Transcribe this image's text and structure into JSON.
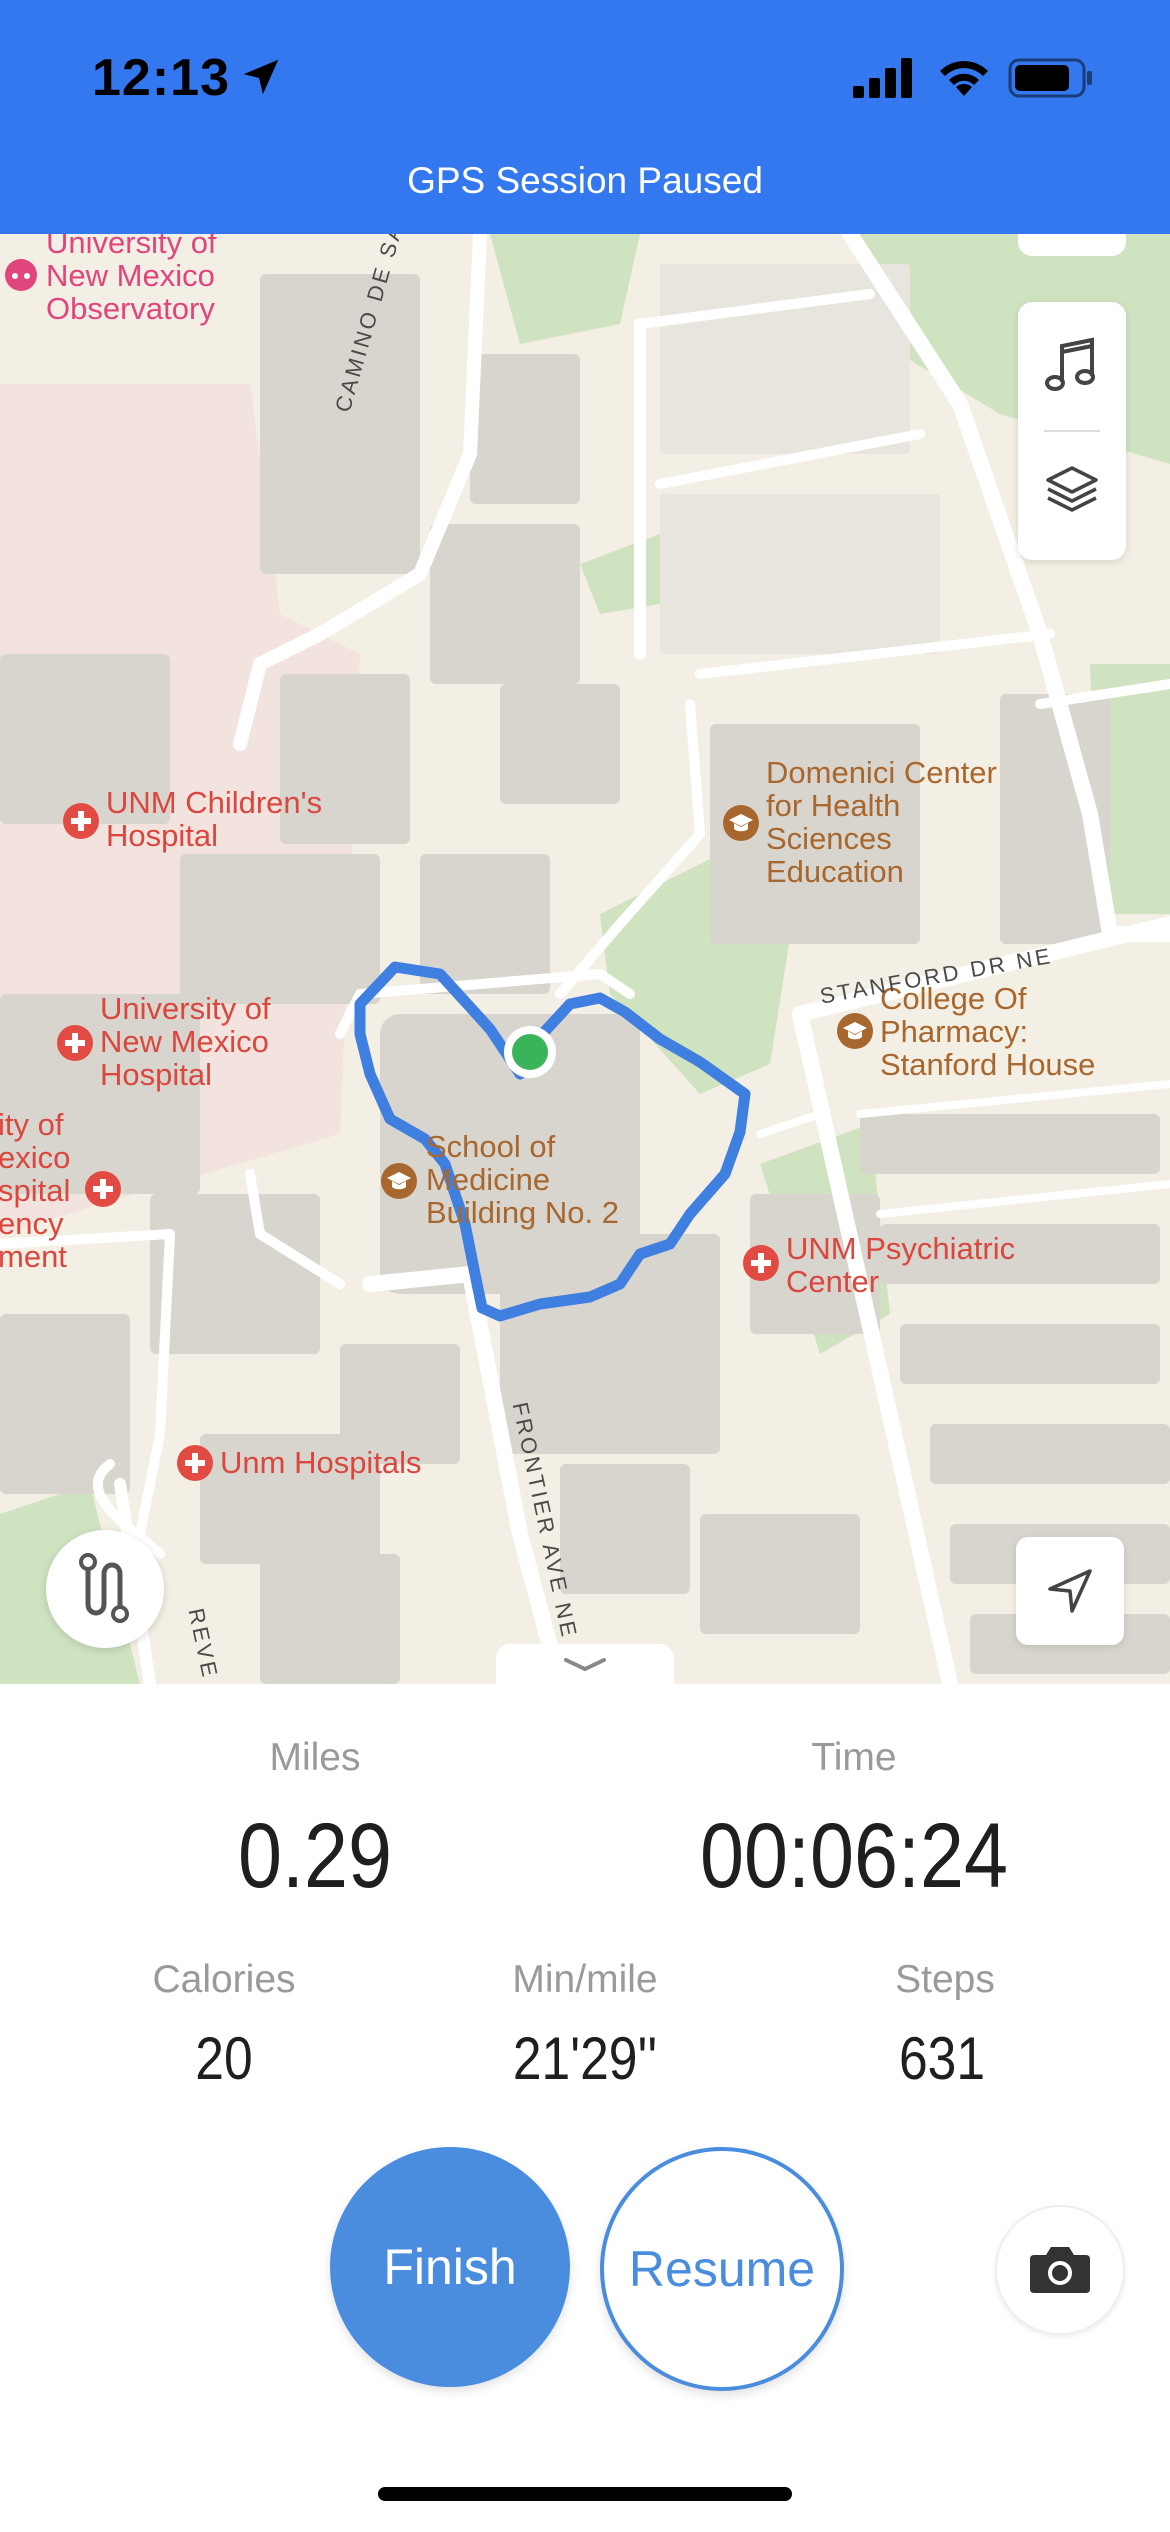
{
  "status_bar": {
    "time": "12:13"
  },
  "header": {
    "title": "GPS Session Paused"
  },
  "map": {
    "pois": [
      {
        "label": "University of New Mexico Observatory",
        "line1": "University of",
        "line2": "New Mexico",
        "line3": "Observatory"
      },
      {
        "label": "UNM Children's Hospital",
        "line1": "UNM Children's",
        "line2": "Hospital"
      },
      {
        "label": "University of New Mexico Hospital",
        "line1": "University of",
        "line2": "New Mexico",
        "line3": "Hospital"
      },
      {
        "line1": "ity of",
        "line2": "exico",
        "line3": "spital",
        "line4": "ency",
        "line5": "ment"
      },
      {
        "label": "Domenici Center for Health Sciences Education",
        "line1": "Domenici Center",
        "line2": "for Health",
        "line3": "Sciences",
        "line4": "Education"
      },
      {
        "label": "College Of Pharmacy: Stanford House",
        "line1": "College Of",
        "line2": "Pharmacy:",
        "line3": "Stanford House"
      },
      {
        "label": "School of Medicine Building No. 2",
        "line1": "School of",
        "line2": "Medicine",
        "line3": "Building No. 2"
      },
      {
        "label": "UNM Psychiatric Center",
        "line1": "UNM Psychiatric",
        "line2": "Center"
      },
      {
        "label": "Unm Hospitals",
        "line1": "Unm Hospitals"
      }
    ],
    "streets": {
      "camino": "CAMINO DE SALUD",
      "stanford": "STANFORD DR NE",
      "frontier": "FRONTIER AVE NE",
      "revere": "REVE"
    },
    "controls": [
      "music-icon",
      "layers-icon",
      "route-icon",
      "navigate-icon",
      "chevron-down-icon"
    ]
  },
  "stats": {
    "miles": {
      "label": "Miles",
      "value": "0.29"
    },
    "time": {
      "label": "Time",
      "value": "00:06:24"
    },
    "calories": {
      "label": "Calories",
      "value": "20"
    },
    "pace": {
      "label": "Min/mile",
      "value": "21'29''"
    },
    "steps": {
      "label": "Steps",
      "value": "631"
    }
  },
  "actions": {
    "finish_label": "Finish",
    "resume_label": "Resume",
    "camera_icon": "camera-icon"
  },
  "colors": {
    "header": "#3478f0",
    "accent": "#4a8cdd",
    "route": "#3f7fe0",
    "position_dot": "#3bb35a"
  }
}
